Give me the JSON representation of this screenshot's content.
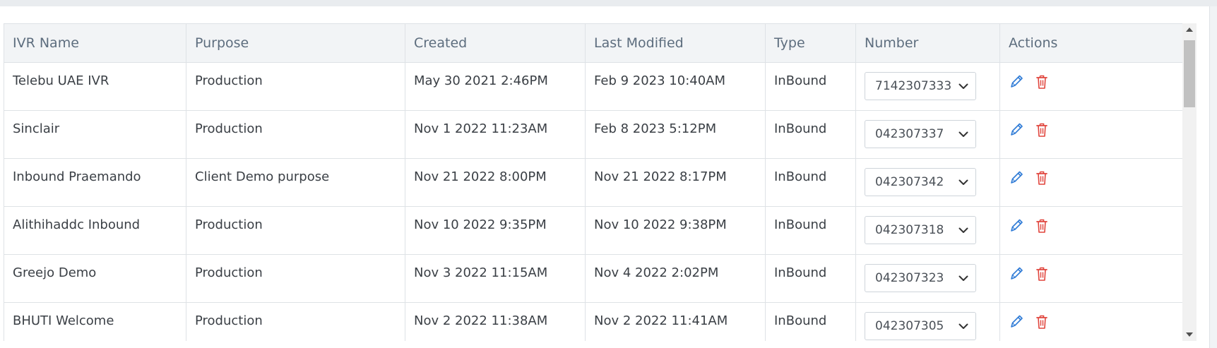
{
  "columns": [
    "IVR Name",
    "Purpose",
    "Created",
    "Last Modified",
    "Type",
    "Number",
    "Actions"
  ],
  "rows": [
    {
      "name": "Telebu UAE IVR",
      "purpose": "Production",
      "created": "May 30 2021 2:46PM",
      "modified": "Feb 9 2023 10:40AM",
      "type": "InBound",
      "number": "7142307333"
    },
    {
      "name": "Sinclair",
      "purpose": "Production",
      "created": "Nov 1 2022 11:23AM",
      "modified": "Feb 8 2023 5:12PM",
      "type": "InBound",
      "number": "042307337"
    },
    {
      "name": "Inbound Praemando",
      "purpose": "Client Demo purpose",
      "created": "Nov 21 2022 8:00PM",
      "modified": "Nov 21 2022 8:17PM",
      "type": "InBound",
      "number": "042307342"
    },
    {
      "name": "Alithihaddc Inbound",
      "purpose": "Production",
      "created": "Nov 10 2022 9:35PM",
      "modified": "Nov 10 2022 9:38PM",
      "type": "InBound",
      "number": "042307318"
    },
    {
      "name": "Greejo Demo",
      "purpose": "Production",
      "created": "Nov 3 2022 11:15AM",
      "modified": "Nov 4 2022 2:02PM",
      "type": "InBound",
      "number": "042307323"
    },
    {
      "name": "BHUTI Welcome",
      "purpose": "Production",
      "created": "Nov 2 2022 11:38AM",
      "modified": "Nov 2 2022 11:41AM",
      "type": "InBound",
      "number": "042307305"
    }
  ],
  "icons": {
    "edit": "pencil-icon",
    "delete": "trash-icon",
    "dropdown": "chevron-down-icon"
  },
  "colors": {
    "edit_icon": "#2f7bd6",
    "delete_icon": "#e0443c",
    "header_bg": "#f2f4f6",
    "border": "#dee2e6"
  }
}
